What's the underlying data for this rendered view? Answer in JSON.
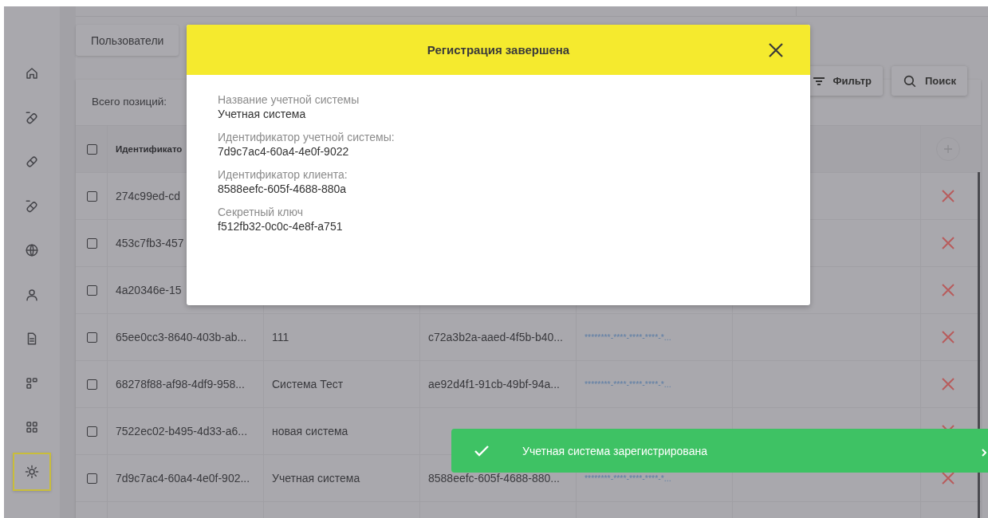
{
  "sidebar": {
    "items": [
      {
        "selected": false
      },
      {
        "selected": false
      },
      {
        "selected": false
      },
      {
        "selected": false
      },
      {
        "selected": false
      },
      {
        "selected": false
      },
      {
        "selected": false
      },
      {
        "selected": false
      },
      {
        "selected": false
      },
      {
        "selected": true
      }
    ]
  },
  "tabs": [
    {
      "label": "Пользователи"
    }
  ],
  "table": {
    "count_label": "Всего позиций:",
    "toolbar_buttons": [
      {
        "kind": "filter",
        "label": "Фильтр"
      },
      {
        "kind": "search",
        "label": "Поиск"
      }
    ],
    "header": {
      "checked": false,
      "column_1": "Идентификато"
    },
    "rows": [
      {
        "checked": false,
        "column_1": "274c99ed-cd"
      },
      {
        "checked": false,
        "column_1": "453c7fb3-457"
      },
      {
        "checked": false,
        "column_1": "4a20346e-15"
      },
      {
        "checked": false,
        "column_1": "65ee0cc3-8640-403b-ab...",
        "column_2": "111",
        "column_3": "c72a3b2a-aaed-4f5b-b40...",
        "column_4": "********-****-****-****-*..."
      },
      {
        "checked": false,
        "column_1": "68278f88-af98-4df9-958...",
        "column_2": "Система Тест",
        "column_3": "ae92d4f1-91cb-49bf-94a...",
        "column_4": "********-****-****-****-*..."
      },
      {
        "checked": false,
        "column_1": "7522ec02-b495-4d33-a6...",
        "column_2": "новая система"
      },
      {
        "checked": false,
        "column_1": "7d9c7ac4-60a4-4e0f-902...",
        "column_2": "Учетная система",
        "column_3": "8588eefc-605f-4688-880...",
        "column_4": "********-****-****-****-*..."
      }
    ]
  },
  "dialog": {
    "title": "Регистрация завершена",
    "fields": [
      {
        "label": "Название учетной системы",
        "value": "Учетная система"
      },
      {
        "label": "Идентификатор учетной системы:",
        "value": "7d9c7ac4-60a4-4e0f-9022"
      },
      {
        "label": "Идентификатор клиента:",
        "value": "8588eefc-605f-4688-880a"
      },
      {
        "label": "Секретный ключ",
        "value": "f512fb32-0c0c-4e8f-a751"
      }
    ]
  },
  "toast": {
    "message": "Учетная система зарегистрирована"
  }
}
